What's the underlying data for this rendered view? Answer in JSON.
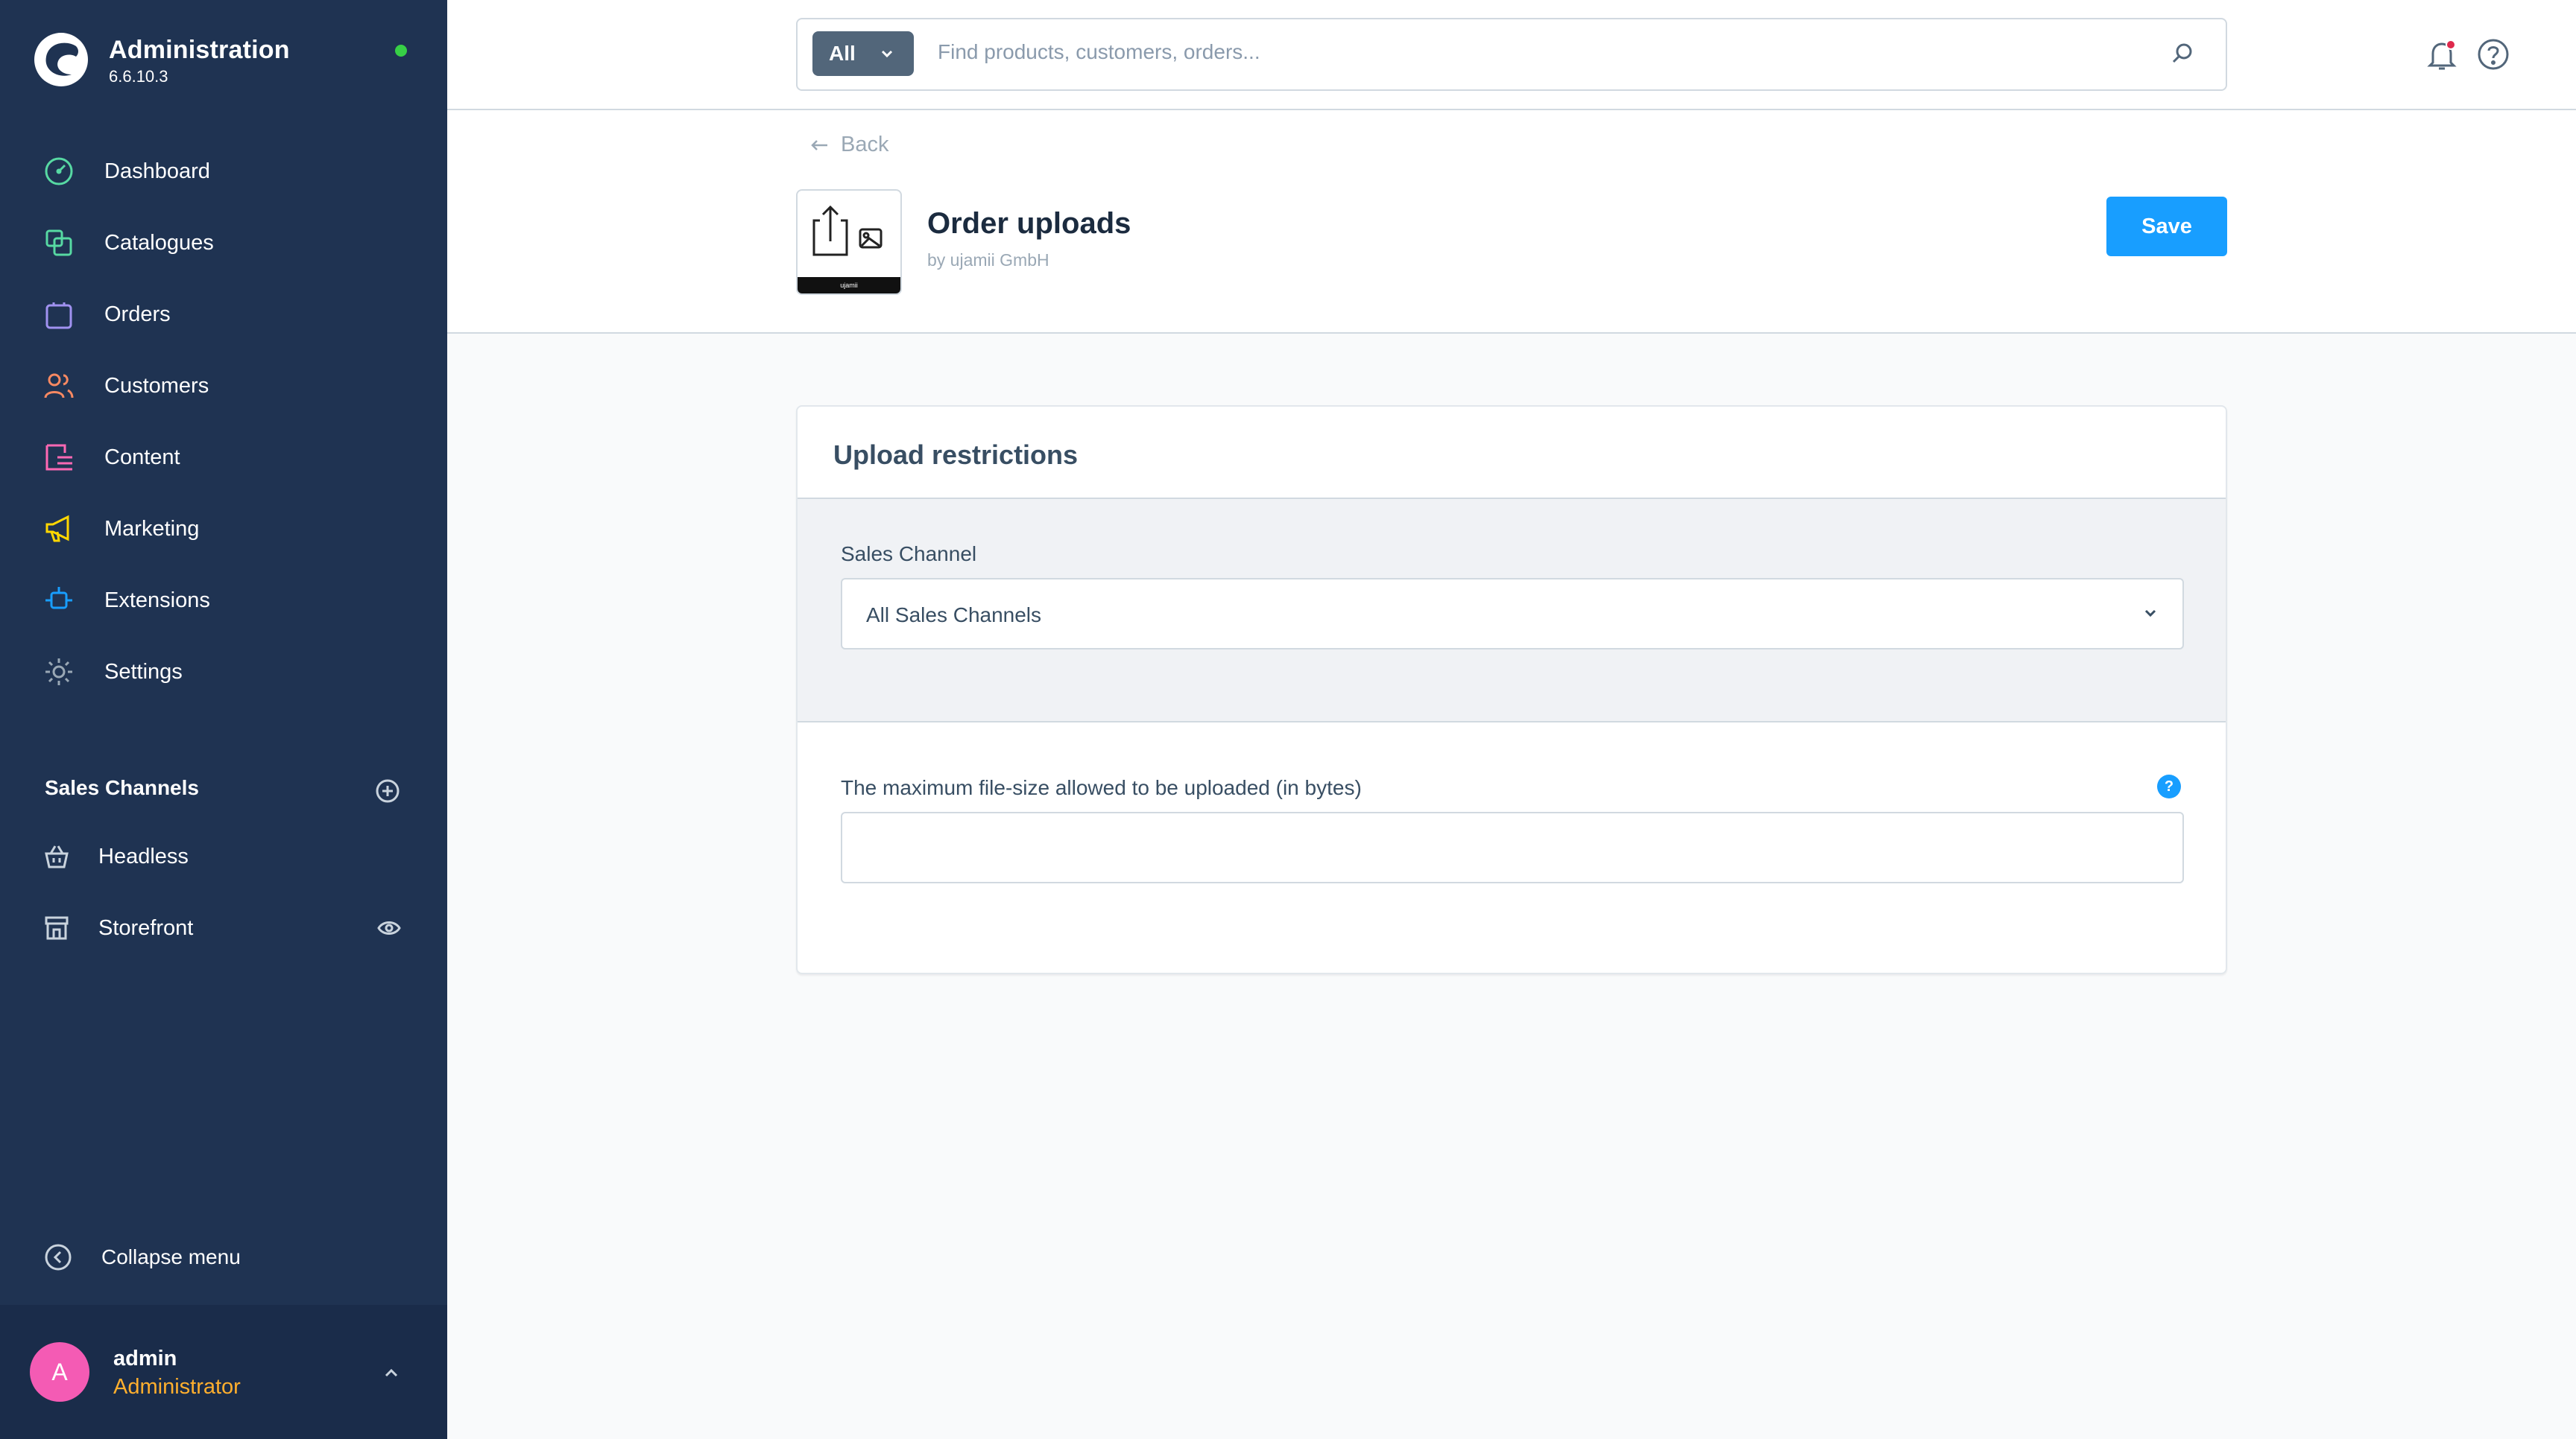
{
  "sidebar": {
    "brand_title": "Administration",
    "brand_version": "6.6.10.3",
    "status_color": "#37d046",
    "items": [
      {
        "label": "Dashboard",
        "icon": "dashboard-icon",
        "color": "#57d9a3"
      },
      {
        "label": "Catalogues",
        "icon": "catalogues-icon",
        "color": "#57d9a3"
      },
      {
        "label": "Orders",
        "icon": "orders-icon",
        "color": "#a092f0"
      },
      {
        "label": "Customers",
        "icon": "customers-icon",
        "color": "#f88962"
      },
      {
        "label": "Content",
        "icon": "content-icon",
        "color": "#ff68b4"
      },
      {
        "label": "Marketing",
        "icon": "marketing-icon",
        "color": "#ffd700"
      },
      {
        "label": "Extensions",
        "icon": "extensions-icon",
        "color": "#189eff"
      },
      {
        "label": "Settings",
        "icon": "settings-icon",
        "color": "#9aa8b5"
      }
    ],
    "sales_channels_heading": "Sales Channels",
    "sales_channels": [
      {
        "label": "Headless",
        "icon": "basket-icon"
      },
      {
        "label": "Storefront",
        "icon": "storefront-icon"
      }
    ],
    "collapse_label": "Collapse menu",
    "user": {
      "initial": "A",
      "name": "admin",
      "role": "Administrator"
    }
  },
  "topbar": {
    "search_type": "All",
    "search_placeholder": "Find products, customers, orders..."
  },
  "header": {
    "back_label": "Back",
    "app_title": "Order uploads",
    "app_vendor": "by ujamii GmbH",
    "app_icon_caption": "ujamii",
    "save_label": "Save"
  },
  "card": {
    "title": "Upload restrictions",
    "sales_channel_label": "Sales Channel",
    "sales_channel_value": "All Sales Channels",
    "max_size_label": "The maximum file-size allowed to be uploaded (in bytes)",
    "max_size_value": "",
    "help_glyph": "?"
  },
  "colors": {
    "sidebar_bg": "#1f3352",
    "accent": "#189eff",
    "role": "#ffaf2e",
    "avatar": "#f45bb4"
  }
}
